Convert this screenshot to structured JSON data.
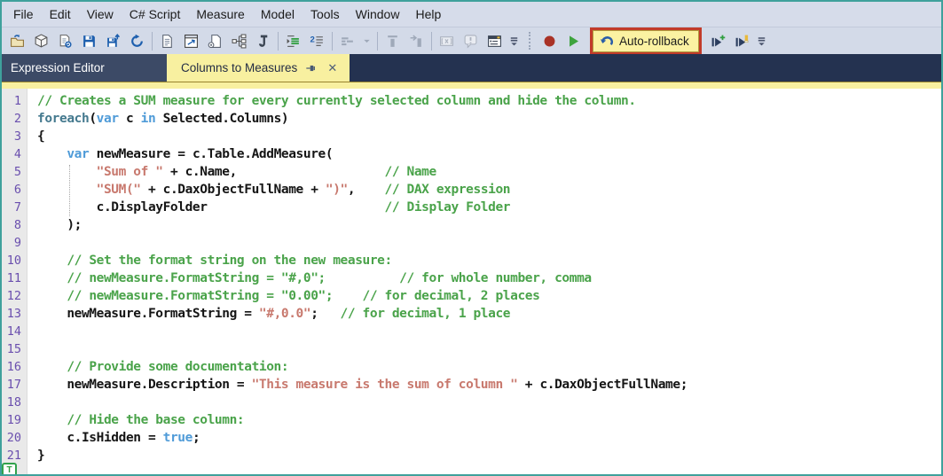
{
  "menu": {
    "items": [
      "File",
      "Edit",
      "View",
      "C# Script",
      "Measure",
      "Model",
      "Tools",
      "Window",
      "Help"
    ]
  },
  "toolbar": {
    "items": [
      {
        "kind": "icon",
        "name": "open-file-icon"
      },
      {
        "kind": "icon",
        "name": "open-database-icon"
      },
      {
        "kind": "icon",
        "name": "refresh-metadata-icon"
      },
      {
        "kind": "icon",
        "name": "save-icon"
      },
      {
        "kind": "icon",
        "name": "save-as-icon"
      },
      {
        "kind": "icon",
        "name": "refresh-icon"
      },
      {
        "kind": "sep"
      },
      {
        "kind": "icon",
        "name": "new-script-icon"
      },
      {
        "kind": "icon",
        "name": "edit-window-icon"
      },
      {
        "kind": "icon",
        "name": "run-script-file-icon"
      },
      {
        "kind": "icon",
        "name": "hierarchy-icon"
      },
      {
        "kind": "icon",
        "name": "script-icon"
      },
      {
        "kind": "sep"
      },
      {
        "kind": "icon",
        "name": "format-indent-icon"
      },
      {
        "kind": "icon",
        "name": "format-code-icon"
      },
      {
        "kind": "sep"
      },
      {
        "kind": "icon",
        "name": "measure-tools-icon",
        "grayed": true
      },
      {
        "kind": "icon",
        "name": "chevron-down-icon",
        "grayed": true,
        "small": true
      },
      {
        "kind": "sep"
      },
      {
        "kind": "icon",
        "name": "column-tools-icon",
        "grayed": true
      },
      {
        "kind": "icon",
        "name": "column-move-icon",
        "grayed": true
      },
      {
        "kind": "sep"
      },
      {
        "kind": "icon",
        "name": "code-actions-icon",
        "grayed": true
      },
      {
        "kind": "icon",
        "name": "comment-warning-icon",
        "grayed": true
      },
      {
        "kind": "icon",
        "name": "form-editor-icon"
      },
      {
        "kind": "icon",
        "name": "overflow-chevron-icon",
        "small": true
      },
      {
        "kind": "grip"
      },
      {
        "kind": "icon",
        "name": "record-icon"
      },
      {
        "kind": "icon",
        "name": "play-icon"
      },
      {
        "kind": "button",
        "name": "auto-rollback-button",
        "label": "Auto-rollback",
        "icon": "undo-arrow-icon",
        "highlighted": true
      },
      {
        "kind": "icon",
        "name": "run-insert-icon"
      },
      {
        "kind": "icon",
        "name": "run-highlight-icon"
      },
      {
        "kind": "icon",
        "name": "overflow-chevron-icon",
        "small": true
      }
    ]
  },
  "tabs": {
    "panel_title": "Expression Editor",
    "active_tab": {
      "label": "Columns to Measures"
    }
  },
  "statusbar": {
    "tray_label": "T"
  },
  "colors": {
    "window_border": "#3fa19c",
    "tab_yellow": "#f8f0a0",
    "highlight_red": "#c23b2a",
    "record_red": "#a93226",
    "play_green": "#3da33d",
    "comment_green": "#4aa34a",
    "string_salmon": "#c8796e",
    "keyword_blue": "#4f9bd8",
    "control_teal": "#44798e",
    "line_number_purple": "#6a4fae"
  },
  "editor": {
    "lines": [
      {
        "n": 1,
        "seg": [
          [
            "com",
            "// Creates a SUM measure for every currently selected column and hide the column."
          ]
        ]
      },
      {
        "n": 2,
        "seg": [
          [
            "ctl",
            "foreach"
          ],
          [
            "def",
            "("
          ],
          [
            "kw",
            "var"
          ],
          [
            "def",
            " c "
          ],
          [
            "kw",
            "in"
          ],
          [
            "def",
            " Selected.Columns)"
          ]
        ]
      },
      {
        "n": 3,
        "seg": [
          [
            "def",
            "{"
          ]
        ]
      },
      {
        "n": 4,
        "seg": [
          [
            "def",
            "    "
          ],
          [
            "kw",
            "var"
          ],
          [
            "def",
            " newMeasure = c.Table.AddMeasure("
          ]
        ]
      },
      {
        "n": 5,
        "seg": [
          [
            "def",
            "        "
          ],
          [
            "str",
            "\"Sum of \""
          ],
          [
            "def",
            " + c.Name,"
          ],
          [
            "def",
            "                    "
          ],
          [
            "com",
            "// Name"
          ]
        ]
      },
      {
        "n": 6,
        "seg": [
          [
            "def",
            "        "
          ],
          [
            "str",
            "\"SUM(\""
          ],
          [
            "def",
            " + c.DaxObjectFullName + "
          ],
          [
            "str",
            "\")\""
          ],
          [
            "def",
            ",    "
          ],
          [
            "com",
            "// DAX expression"
          ]
        ]
      },
      {
        "n": 7,
        "seg": [
          [
            "def",
            "        c.DisplayFolder"
          ],
          [
            "def",
            "                        "
          ],
          [
            "com",
            "// Display Folder"
          ]
        ]
      },
      {
        "n": 8,
        "seg": [
          [
            "def",
            "    );"
          ]
        ]
      },
      {
        "n": 9,
        "seg": []
      },
      {
        "n": 10,
        "seg": [
          [
            "def",
            "    "
          ],
          [
            "com",
            "// Set the format string on the new measure:"
          ]
        ]
      },
      {
        "n": 11,
        "seg": [
          [
            "def",
            "    "
          ],
          [
            "com",
            "// newMeasure.FormatString = \"#,0\";          // for whole number, comma"
          ]
        ]
      },
      {
        "n": 12,
        "seg": [
          [
            "def",
            "    "
          ],
          [
            "com",
            "// newMeasure.FormatString = \"0.00\";    // for decimal, 2 places"
          ]
        ]
      },
      {
        "n": 13,
        "seg": [
          [
            "def",
            "    newMeasure.FormatString = "
          ],
          [
            "str",
            "\"#,0.0\""
          ],
          [
            "def",
            ";   "
          ],
          [
            "com",
            "// for decimal, 1 place"
          ]
        ]
      },
      {
        "n": 14,
        "seg": []
      },
      {
        "n": 15,
        "seg": []
      },
      {
        "n": 16,
        "seg": [
          [
            "def",
            "    "
          ],
          [
            "com",
            "// Provide some documentation:"
          ]
        ]
      },
      {
        "n": 17,
        "seg": [
          [
            "def",
            "    newMeasure.Description = "
          ],
          [
            "str",
            "\"This measure is the sum of column \""
          ],
          [
            "def",
            " + c.DaxObjectFullName;"
          ]
        ]
      },
      {
        "n": 18,
        "seg": []
      },
      {
        "n": 19,
        "seg": [
          [
            "def",
            "    "
          ],
          [
            "com",
            "// Hide the base column:"
          ]
        ]
      },
      {
        "n": 20,
        "seg": [
          [
            "def",
            "    c.IsHidden = "
          ],
          [
            "kw",
            "true"
          ],
          [
            "def",
            ";"
          ]
        ]
      },
      {
        "n": 21,
        "seg": [
          [
            "def",
            "}"
          ]
        ]
      }
    ]
  }
}
